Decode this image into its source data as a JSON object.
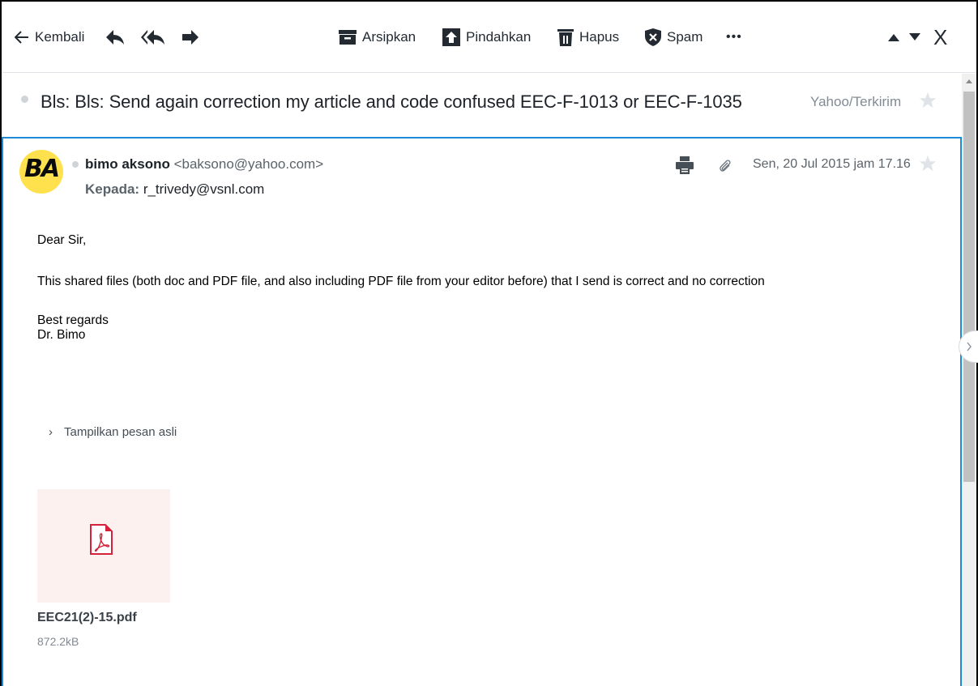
{
  "toolbar": {
    "back_label": "Kembali",
    "archive_label": "Arsipkan",
    "move_label": "Pindahkan",
    "delete_label": "Hapus",
    "spam_label": "Spam",
    "more_label": "•••",
    "close_label": "X"
  },
  "subject": {
    "text": "Bls: Bls: Send again correction my article and code confused EEC-F-1013 or EEC-F-1035",
    "folder": "Yahoo/Terkirim"
  },
  "message": {
    "avatar_initials": "BA",
    "sender_name": "bimo aksono",
    "sender_email": "<baksono@yahoo.com>",
    "to_label": "Kepada:",
    "to_address": "r_trivedy@vsnl.com",
    "date": "Sen, 20 Jul 2015 jam 17.16",
    "body": {
      "greeting": "Dear Sir,",
      "paragraph": "This shared files (both doc and PDF file, and also  including PDF file from your editor before) that I send is correct and no correction",
      "closing": "Best regards",
      "signature": "Dr. Bimo"
    },
    "show_original_label": "Tampilkan pesan asli",
    "attachment": {
      "name": "EEC21(2)-15.pdf",
      "size": "872.2kB"
    }
  },
  "colors": {
    "accent": "#1d8bd6",
    "avatar_bg": "#ffe04d",
    "attachment_bg": "#fdf1ef",
    "pdf_red": "#d6213a"
  },
  "icons": [
    "arrow-left-icon",
    "reply-icon",
    "reply-all-icon",
    "forward-icon",
    "archive-icon",
    "move-icon",
    "trash-icon",
    "spam-shield-icon",
    "more-icon",
    "caret-up-icon",
    "caret-down-icon",
    "close-icon",
    "star-icon",
    "print-icon",
    "paperclip-icon",
    "chevron-right-icon",
    "pdf-file-icon"
  ]
}
